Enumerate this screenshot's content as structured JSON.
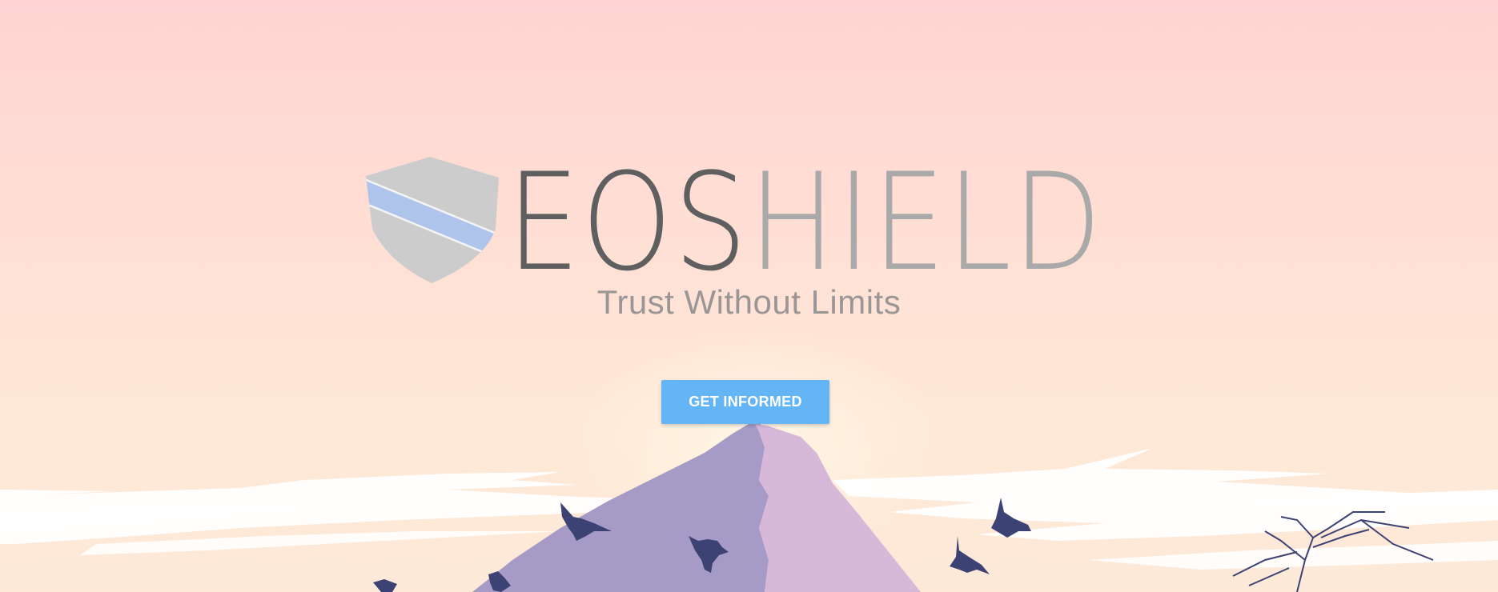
{
  "brand": {
    "name_part_1": "EOS",
    "name_part_2": "HIELD"
  },
  "hero": {
    "tagline": "Trust Without Limits",
    "cta_label": "GET INFORMED"
  },
  "colors": {
    "accent": "#64b5f6",
    "wordmark_dark": "#5f5f5f",
    "wordmark_light": "#a9a9a9",
    "shield_gray": "#cccccc",
    "shield_stripe": "#aec4ea",
    "mountain_left": "#a59bc6",
    "mountain_right": "#d8b8d8",
    "birds": "#3d4275"
  },
  "icons": {
    "logo": "shield-icon"
  }
}
